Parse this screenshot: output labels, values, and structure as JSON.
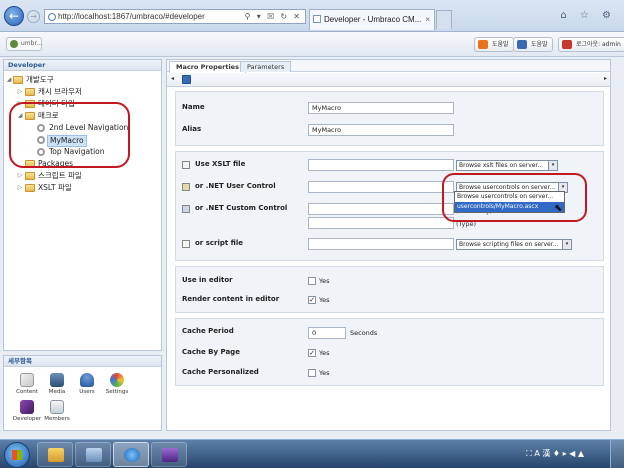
{
  "browser": {
    "url": "http://localhost:1867/umbraco/#developer",
    "address_tools": "⚲ ▾ ☒ ↻ ✕",
    "tab_title": "Developer - Umbraco CM...",
    "tab_close": "×",
    "back": "←",
    "forward": "→",
    "chrome_tools": "⌂ ☆ ⚙"
  },
  "topbar": {
    "logo_label": "umbr...",
    "help_label": "도움말",
    "about_label": "도움말",
    "logout_label": "로그아웃: admin"
  },
  "tree": {
    "title": "Developer",
    "items": [
      {
        "label": "개발도구"
      },
      {
        "label": "캐시 브라우저"
      },
      {
        "label": "데이터 타입"
      },
      {
        "label": "매크로"
      },
      {
        "label": "2nd Level Navigation"
      },
      {
        "label": "MyMacro"
      },
      {
        "label": "Top Navigation"
      },
      {
        "label": "Packages"
      },
      {
        "label": "스크립트 파일"
      },
      {
        "label": "XSLT 파일"
      }
    ]
  },
  "sections": {
    "title": "세부항목",
    "items": [
      {
        "label": "Content"
      },
      {
        "label": "Media"
      },
      {
        "label": "Users"
      },
      {
        "label": "Settings"
      },
      {
        "label": "Developer"
      },
      {
        "label": "Members"
      }
    ]
  },
  "main": {
    "tabs": [
      {
        "label": "Macro Properties"
      },
      {
        "label": "Parameters"
      }
    ],
    "toolbar": {
      "left_arrow": "◂",
      "right_arrow": "▸"
    },
    "name_label": "Name",
    "name_value": "MyMacro",
    "alias_label": "Alias",
    "alias_value": "MyMacro",
    "xslt_label": "Use XSLT file",
    "xslt_select": "Browse xslt files on server...",
    "net_user_label": "or .NET User Control",
    "net_user_select": "Browse usercontrols on server...",
    "dropdown_options": [
      "Browse usercontrols on server...",
      "usercontrols/MyMacro.ascx"
    ],
    "net_custom_label": "or .NET Custom Control",
    "assembly_hint": "(Assembly)",
    "type_hint": "(Type)",
    "script_label": "or script file",
    "script_select": "Browse scripting files on server...",
    "use_in_editor_label": "Use in editor",
    "use_in_editor_yes": "Yes",
    "render_label": "Render content in editor",
    "render_yes": "Yes",
    "cache_period_label": "Cache Period",
    "cache_period_value": "0",
    "cache_period_unit": "Seconds",
    "cache_by_page_label": "Cache By Page",
    "cache_by_page_yes": "Yes",
    "cache_personalized_label": "Cache Personalized",
    "cache_personalized_yes": "Yes",
    "dropdown_arrow": "▾",
    "check_mark": "✓"
  },
  "taskbar": {
    "tray_text": "⛶ A 漢 ♦ ▸ ◀ ▲"
  },
  "colors": {
    "highlight": "#c41820",
    "selection": "#3169c6",
    "accent": "#2b5a91"
  }
}
